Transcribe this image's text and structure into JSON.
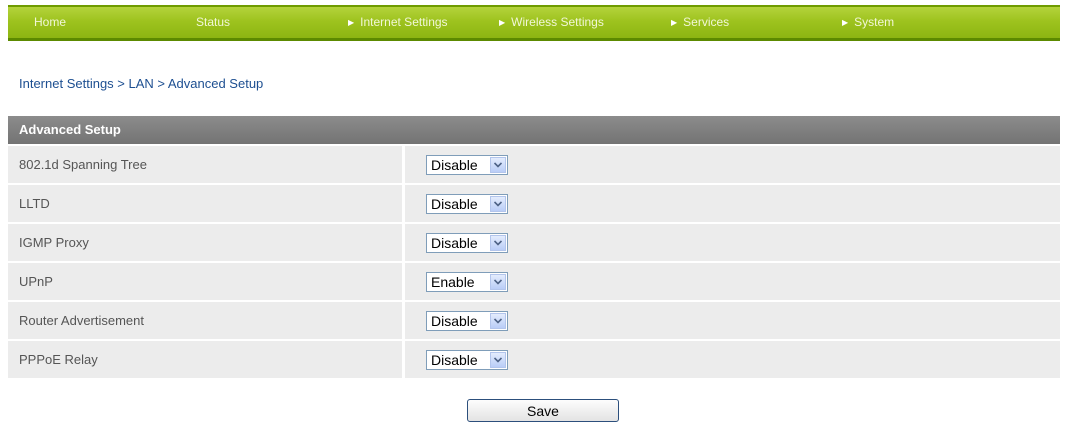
{
  "nav": {
    "items": [
      {
        "label": "Home",
        "arrow": false
      },
      {
        "label": "Status",
        "arrow": false
      },
      {
        "label": "Internet Settings",
        "arrow": true
      },
      {
        "label": "Wireless Settings",
        "arrow": true
      },
      {
        "label": "Services",
        "arrow": true
      },
      {
        "label": "System",
        "arrow": true
      }
    ]
  },
  "breadcrumb": "Internet Settings > LAN > Advanced Setup",
  "panel": {
    "title": "Advanced Setup",
    "rows": [
      {
        "label": "802.1d Spanning Tree",
        "value": "Disable"
      },
      {
        "label": "LLTD",
        "value": "Disable"
      },
      {
        "label": "IGMP Proxy",
        "value": "Disable"
      },
      {
        "label": "UPnP",
        "value": "Enable"
      },
      {
        "label": "Router Advertisement",
        "value": "Disable"
      },
      {
        "label": "PPPoE Relay",
        "value": "Disable"
      }
    ]
  },
  "save_label": "Save",
  "colors": {
    "nav_green": "#9ec31e",
    "header_gray": "#808080",
    "row_bg": "#ececec",
    "link_blue": "#1d4f91"
  },
  "icons": {
    "nav_arrow": "triangle-right-icon",
    "select_arrow": "chevron-down-icon"
  }
}
